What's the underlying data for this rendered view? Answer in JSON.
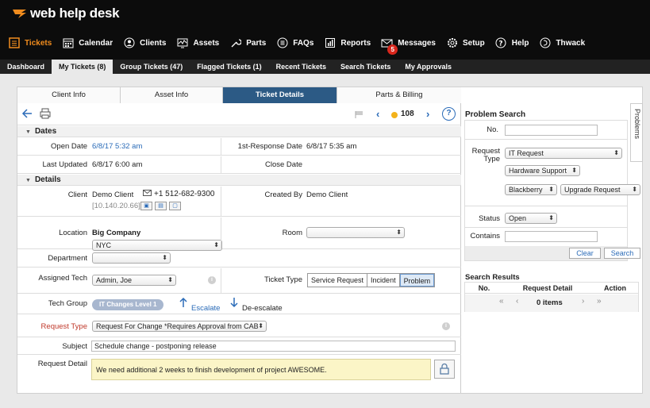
{
  "brand": {
    "name": "web help desk"
  },
  "nav": {
    "items": [
      {
        "label": "Tickets",
        "icon": "tickets-icon",
        "active": true
      },
      {
        "label": "Calendar",
        "icon": "calendar-icon"
      },
      {
        "label": "Clients",
        "icon": "clients-icon"
      },
      {
        "label": "Assets",
        "icon": "assets-icon"
      },
      {
        "label": "Parts",
        "icon": "parts-icon"
      },
      {
        "label": "FAQs",
        "icon": "faqs-icon"
      },
      {
        "label": "Reports",
        "icon": "reports-icon"
      },
      {
        "label": "Messages",
        "icon": "messages-icon",
        "badge": "5"
      },
      {
        "label": "Setup",
        "icon": "setup-icon"
      },
      {
        "label": "Help",
        "icon": "help-icon"
      },
      {
        "label": "Thwack",
        "icon": "thwack-icon"
      }
    ]
  },
  "subnav": {
    "items": [
      {
        "label": "Dashboard"
      },
      {
        "label": "My Tickets (8)",
        "active": true
      },
      {
        "label": "Group Tickets (47)"
      },
      {
        "label": "Flagged Tickets (1)"
      },
      {
        "label": "Recent Tickets"
      },
      {
        "label": "Search Tickets"
      },
      {
        "label": "My Approvals"
      }
    ]
  },
  "tabs": [
    {
      "label": "Client Info"
    },
    {
      "label": "Asset Info"
    },
    {
      "label": "Ticket Details",
      "active": true
    },
    {
      "label": "Parts & Billing"
    }
  ],
  "toolbar": {
    "ticket_number": "108"
  },
  "dates": {
    "section": "Dates",
    "open_date_label": "Open Date",
    "open_date": "6/8/17 5:32 am",
    "first_response_label": "1st-Response Date",
    "first_response": "6/8/17 5:35 am",
    "last_updated_label": "Last Updated",
    "last_updated": "6/8/17 6:00 am",
    "close_date_label": "Close Date",
    "close_date": ""
  },
  "details": {
    "section": "Details",
    "client_label": "Client",
    "client": "Demo Client",
    "phone": "+1 512-682-9300",
    "ip": "[10.140.20.66]",
    "created_by_label": "Created By",
    "created_by": "Demo Client",
    "location_label": "Location",
    "location": "Big Company",
    "location_select": "NYC",
    "room_label": "Room",
    "room_select": "",
    "department_label": "Department",
    "department_select": "",
    "assigned_tech_label": "Assigned Tech",
    "assigned_tech": "Admin, Joe",
    "ticket_type_label": "Ticket Type",
    "ticket_types": [
      "Service Request",
      "Incident",
      "Problem"
    ],
    "ticket_type_selected": "Problem",
    "tech_group_label": "Tech Group",
    "tech_group": "IT Changes  Level 1",
    "escalate": "Escalate",
    "deescalate": "De-escalate",
    "request_type_label": "Request Type",
    "request_type": "Request For Change *Requires Approval from CAB",
    "subject_label": "Subject",
    "subject": "Schedule change - postponing release",
    "request_detail_label": "Request Detail",
    "request_detail": "We need additional 2 weeks to finish development of project AWESOME."
  },
  "problem_search": {
    "title": "Problem Search",
    "side_tab": "Problems",
    "no_label": "No.",
    "no_value": "",
    "request_type_label": "Request Type",
    "request_type": "IT Request",
    "sub_type": "Hardware Support",
    "device": "Blackberry",
    "action": "Upgrade Request",
    "status_label": "Status",
    "status": "Open",
    "contains_label": "Contains",
    "contains_value": "",
    "clear": "Clear",
    "search": "Search"
  },
  "search_results": {
    "title": "Search Results",
    "columns": [
      "No.",
      "Request Detail",
      "Action"
    ],
    "items_text": "0 items"
  },
  "colors": {
    "accent": "#f08c1e",
    "active_tab": "#2c5a85",
    "link": "#2a6bb8",
    "badge": "#d9261c",
    "required": "#c0392b"
  }
}
